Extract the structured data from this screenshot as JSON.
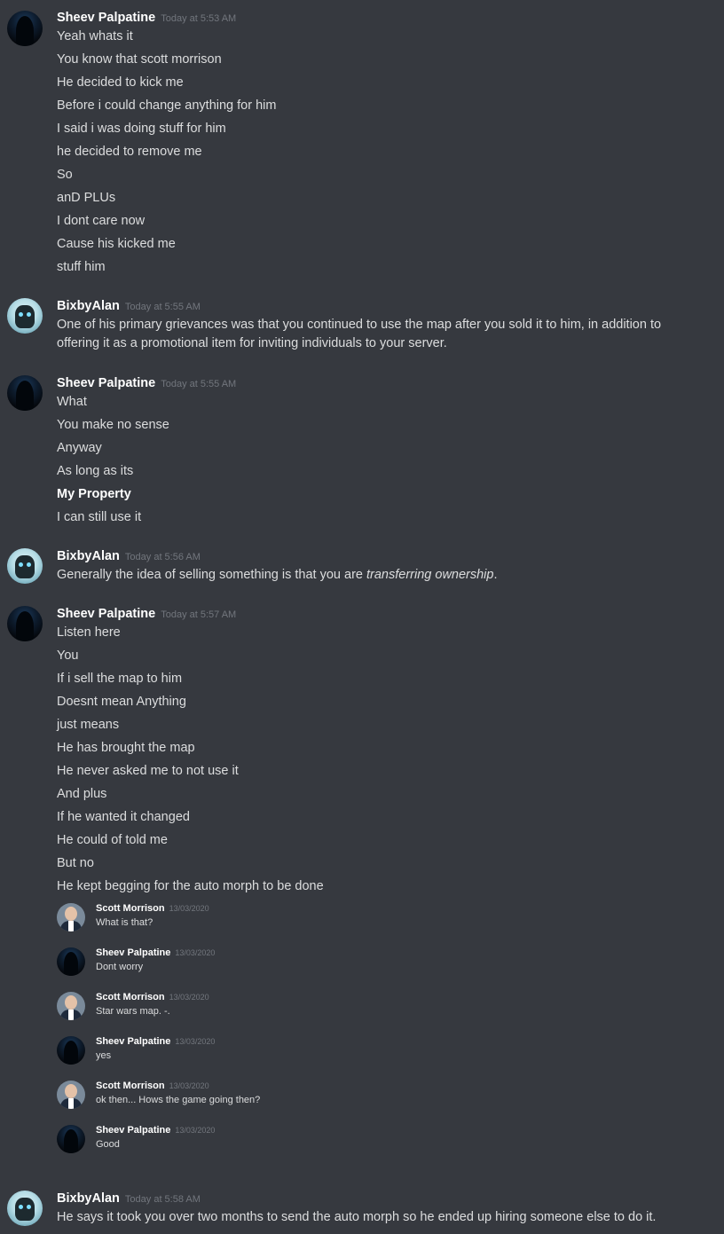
{
  "groups": [
    {
      "username": "Sheev Palpatine",
      "timestamp": "Today at 5:53 AM",
      "avatar": "hooded-figure-avatar",
      "lines": [
        "Yeah whats it",
        "You know that scott morrison",
        "He decided to kick me",
        "Before i could change anything for him",
        "I said i was doing stuff for him",
        "he decided to remove me",
        "So",
        "anD PLUs",
        "I dont care now",
        "Cause his kicked me",
        "stuff him"
      ]
    },
    {
      "username": "BixbyAlan",
      "timestamp": "Today at 5:55 AM",
      "avatar": "robot-avatar",
      "lines": [
        "One of his primary grievances was that you continued to use the map after you sold it to him, in addition to offering it as a promotional item for inviting individuals to your server."
      ]
    },
    {
      "username": "Sheev Palpatine",
      "timestamp": "Today at 5:55 AM",
      "avatar": "hooded-figure-avatar",
      "lines": [
        "What",
        "You make no sense",
        "Anyway",
        "As long as its",
        "My Property",
        "I can still use it"
      ]
    },
    {
      "username": "BixbyAlan",
      "timestamp": "Today at 5:56 AM",
      "avatar": "robot-avatar",
      "text_before": "Generally the idea of selling something is that you are ",
      "text_italic": "transferring ownership",
      "text_after": "."
    },
    {
      "username": "Sheev Palpatine",
      "timestamp": "Today at 5:57 AM",
      "avatar": "hooded-figure-avatar",
      "lines": [
        "Listen here",
        "You",
        "If i sell the map to him",
        "Doesnt mean Anything",
        "just means",
        "He has brought the map",
        "He never asked me to not use it",
        "And plus",
        "If he wanted it changed",
        "He could of told me",
        "But no",
        "He kept begging for the auto morph to be done"
      ]
    },
    {
      "username": "BixbyAlan",
      "timestamp": "Today at 5:58 AM",
      "avatar": "robot-avatar",
      "lines": [
        "He says it took you over two months to send the auto morph so he ended up hiring someone else to do it."
      ]
    }
  ],
  "embedded_screenshot": [
    {
      "username": "Scott Morrison",
      "timestamp": "13/03/2020",
      "text": "What is that?",
      "avatar": "scott-morrison-avatar"
    },
    {
      "username": "Sheev Palpatine",
      "timestamp": "13/03/2020",
      "text": "Dont worry",
      "avatar": "hooded-figure-avatar"
    },
    {
      "username": "Scott Morrison",
      "timestamp": "13/03/2020",
      "text": "Star wars map. -.",
      "avatar": "scott-morrison-avatar"
    },
    {
      "username": "Sheev Palpatine",
      "timestamp": "13/03/2020",
      "text": "yes",
      "avatar": "hooded-figure-avatar"
    },
    {
      "username": "Scott Morrison",
      "timestamp": "13/03/2020",
      "text": "ok then... Hows the game going then?",
      "avatar": "scott-morrison-avatar"
    },
    {
      "username": "Sheev Palpatine",
      "timestamp": "13/03/2020",
      "text": "Good",
      "avatar": "hooded-figure-avatar"
    }
  ],
  "colors": {
    "background": "#36393f",
    "username": "#ffffff",
    "message_text": "#dcddde",
    "timestamp": "#72767d"
  }
}
